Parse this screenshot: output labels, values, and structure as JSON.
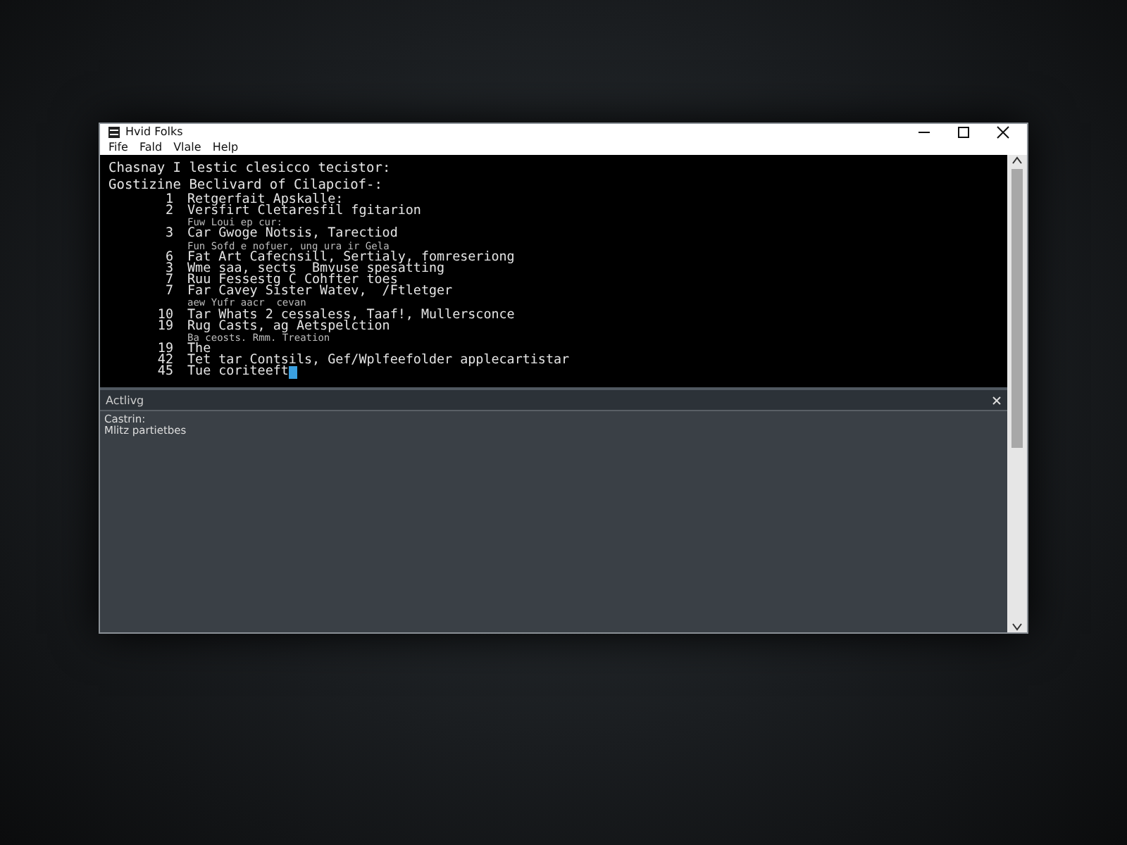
{
  "window": {
    "title": "Hvid Folks"
  },
  "menu": [
    "Fife",
    "Fald",
    "Vlale",
    "Help"
  ],
  "console": {
    "header": [
      "Chasnay I lestic clesicco tecistor:",
      "Gostizine Beclivard of Cilapciof-:"
    ],
    "lines": [
      {
        "number": "1",
        "text": "Retgerfait Apskalle:"
      },
      {
        "number": "2",
        "text": "Versfirt Cletaresfil fgitarion"
      },
      {
        "text": "Fuw Loui ep cur:"
      },
      {
        "number": "3",
        "text": "Car Gwoge Notsis, Tarectiod"
      },
      {
        "text": "Fun Sofd e nofuer, ung ura ir Gela"
      },
      {
        "number": "6",
        "text": "Fat Art Cafecnsill, Sertialy, fomreseriong"
      },
      {
        "number": "3",
        "text": "Wme saa, sects  Bmvuse spesatting"
      },
      {
        "number": "7",
        "text": "Ruu Fessestg C Cohfter toes"
      },
      {
        "number": "7",
        "text": "Far Cavey Sister Watev,  /Ftletger"
      },
      {
        "text": "aew Yufr aacr  cevan"
      },
      {
        "number": "10",
        "text": "Tar Whats 2 cessaless, Taaf!, Mullersconce"
      },
      {
        "number": "19",
        "text": "Rug Casts, ag Aetspelction"
      },
      {
        "text": "Ba ceosts. Rmm. Treation"
      },
      {
        "number": "19",
        "text": "The"
      },
      {
        "number": "42",
        "text": "Tet tar Contsils, Gef/Wplfeefolder applecartistar"
      },
      {
        "number": "45",
        "text": "Tue coriteeft",
        "cursor": true
      }
    ]
  },
  "panel": {
    "title": "Actlivg",
    "lines": [
      "Castrin:",
      "Mlitz partietbes"
    ]
  }
}
